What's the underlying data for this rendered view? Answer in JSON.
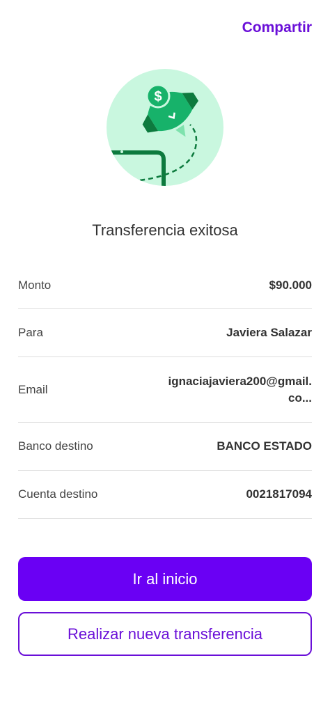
{
  "header": {
    "share_label": "Compartir"
  },
  "illustration": {
    "icon": "rocket-money-icon",
    "bg_color": "#c9f7df",
    "accent_color": "#17b26a"
  },
  "title": "Transferencia exitosa",
  "details": [
    {
      "label": "Monto",
      "value": "$90.000"
    },
    {
      "label": "Para",
      "value": "Javiera Salazar"
    },
    {
      "label": "Email",
      "value": "ignaciajaviera200@gmail.co..."
    },
    {
      "label": "Banco destino",
      "value": "BANCO ESTADO"
    },
    {
      "label": "Cuenta destino",
      "value": "0021817094"
    }
  ],
  "actions": {
    "primary_label": "Ir al inicio",
    "secondary_label": "Realizar nueva transferencia"
  },
  "colors": {
    "brand": "#6a00f4",
    "text": "#333333",
    "divider": "#dddddd"
  }
}
